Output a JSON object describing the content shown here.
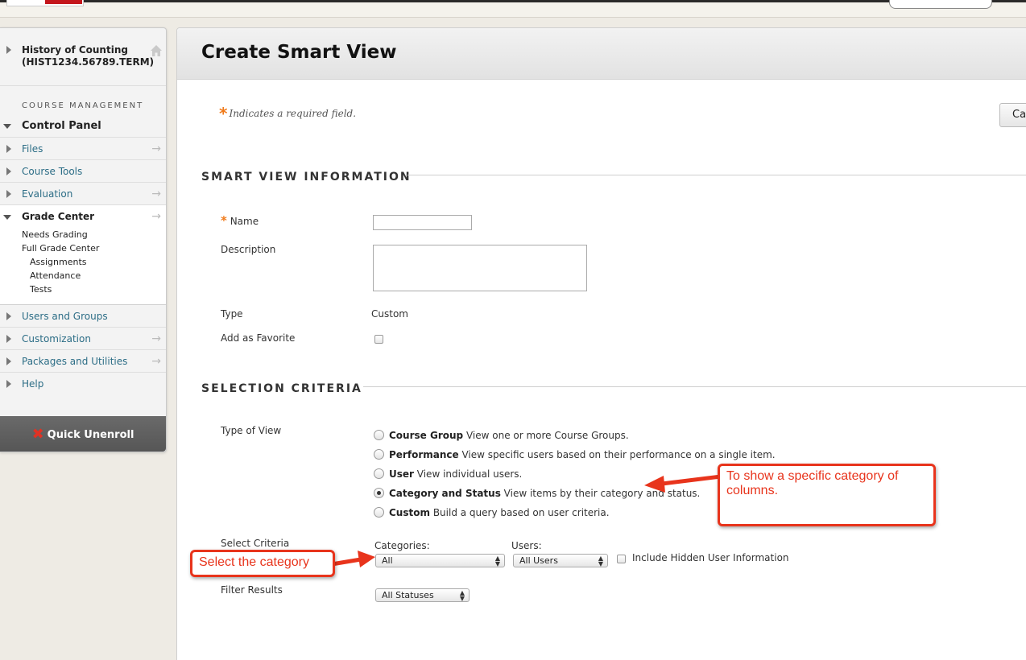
{
  "sidebar": {
    "course_title": "History of Counting",
    "course_id": "(HIST1234.56789.TERM)",
    "section_label": "COURSE MANAGEMENT",
    "control_panel": "Control Panel",
    "items_top": [
      {
        "label": "Files",
        "arrow": "→"
      },
      {
        "label": "Course Tools",
        "arrow": ""
      },
      {
        "label": "Evaluation",
        "arrow": "→"
      }
    ],
    "grade_center": {
      "label": "Grade Center",
      "arrow": "→",
      "needs_grading": "Needs Grading",
      "full_grade_center": "Full Grade Center",
      "children": [
        "Assignments",
        "Attendance",
        "Tests"
      ]
    },
    "items_bottom": [
      {
        "label": "Users and Groups",
        "arrow": ""
      },
      {
        "label": "Customization",
        "arrow": "→"
      },
      {
        "label": "Packages and Utilities",
        "arrow": "→"
      },
      {
        "label": "Help",
        "arrow": ""
      }
    ],
    "quick_unenroll": "Quick Unenroll"
  },
  "main": {
    "title": "Create Smart View",
    "required_star": "*",
    "required_note": "Indicates a required field.",
    "cancel_label": "Ca",
    "info_section": "SMART VIEW INFORMATION",
    "name_label": "Name",
    "description_label": "Description",
    "type_label": "Type",
    "type_value": "Custom",
    "favorite_label": "Add as Favorite",
    "criteria_section": "SELECTION CRITERIA",
    "type_of_view_label": "Type of View",
    "view_options": [
      {
        "name": "Course Group",
        "desc": "View one or more Course Groups.",
        "selected": false
      },
      {
        "name": "Performance",
        "desc": "View specific users based on their performance on a single item.",
        "selected": false
      },
      {
        "name": "User",
        "desc": "View individual users.",
        "selected": false
      },
      {
        "name": "Category and Status",
        "desc": "View items by their category and status.",
        "selected": true
      },
      {
        "name": "Custom",
        "desc": "Build a query based on user criteria.",
        "selected": false
      }
    ],
    "select_criteria_label": "Select Criteria",
    "categories_label": "Categories:",
    "categories_value": "All",
    "users_label": "Users:",
    "users_value": "All Users",
    "hidden_info_label": "Include Hidden User Information",
    "filter_label": "Filter Results",
    "filter_value": "All Statuses"
  },
  "annotations": {
    "callout_category": "To show a specific category of columns.",
    "callout_select": "Select the category"
  },
  "colors": {
    "accent_orange": "#f07a1a",
    "link": "#2c6d86",
    "annotation_red": "#e8341c"
  },
  "icons": [
    "home-icon",
    "expand-triangle-icon",
    "collapse-triangle-icon",
    "arrow-right-icon",
    "close-x-icon",
    "select-caret-icon"
  ]
}
